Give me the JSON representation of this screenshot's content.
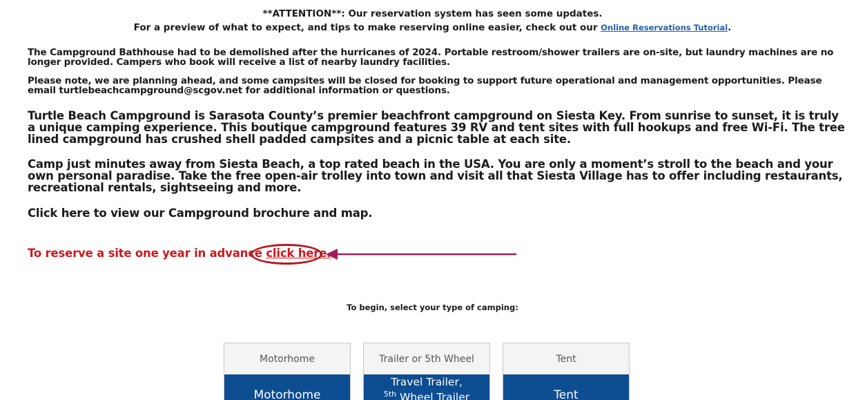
{
  "attention": {
    "line1": "**ATTENTION**: Our reservation system has seen some updates.",
    "line2_prefix": "For a preview of what to expect, and tips to make reserving online easier, check out our ",
    "tutorial_link": "Online Reservations Tutorial",
    "line2_suffix": "."
  },
  "notices": {
    "bathhouse": "The Campground Bathhouse had to be demolished after the hurricanes of 2024. Portable restroom/shower trailers are on-site, but laundry machines are no longer provided. Campers who book will receive a list of nearby laundry facilities.",
    "planning": "Please note, we are planning ahead, and some campsites will be closed for booking to support future operational and management opportunities. Please email turtlebeachcampground@scgov.net for additional information or questions."
  },
  "intro": {
    "paragraph1": "Turtle Beach Campground is Sarasota County’s premier beachfront campground on Siesta Key. From sunrise to sunset, it is truly a unique camping experience. This boutique campground features 39 RV and tent sites with full hookups and free Wi-Fi. The tree lined campground has crushed shell padded campsites and a picnic table at each site.",
    "p2_a": "Camp just minutes away from ",
    "p2_b": "Siesta Beach, a top rated beach in the USA.",
    "p2_c": " You are only a moment’s stroll to the beach and your own personal paradise. Take the ",
    "p2_d": "free open-air trolley",
    "p2_e": " into town and visit all that Siesta Village has to offer including restaurants, recreational rentals, sightseeing and more.",
    "brochure": "Click here to view our Campground brochure and map."
  },
  "advance": {
    "text": "To reserve a site one year in advance ",
    "link": "click here."
  },
  "begin_label": "To begin, select your type of camping:",
  "camping_types": [
    {
      "header": "Motorhome",
      "button": "Motorhome"
    },
    {
      "header": "Trailer or 5th Wheel",
      "button_line1": "Travel Trailer,",
      "button_sup": "5th",
      "button_line2": " Wheel Trailer"
    },
    {
      "header": "Tent",
      "button": "Tent"
    }
  ],
  "colors": {
    "accent_blue": "#0d4d92",
    "link_blue": "#1f5fa8",
    "alert_red": "#d0181c",
    "annotation": "#a01f5a"
  }
}
